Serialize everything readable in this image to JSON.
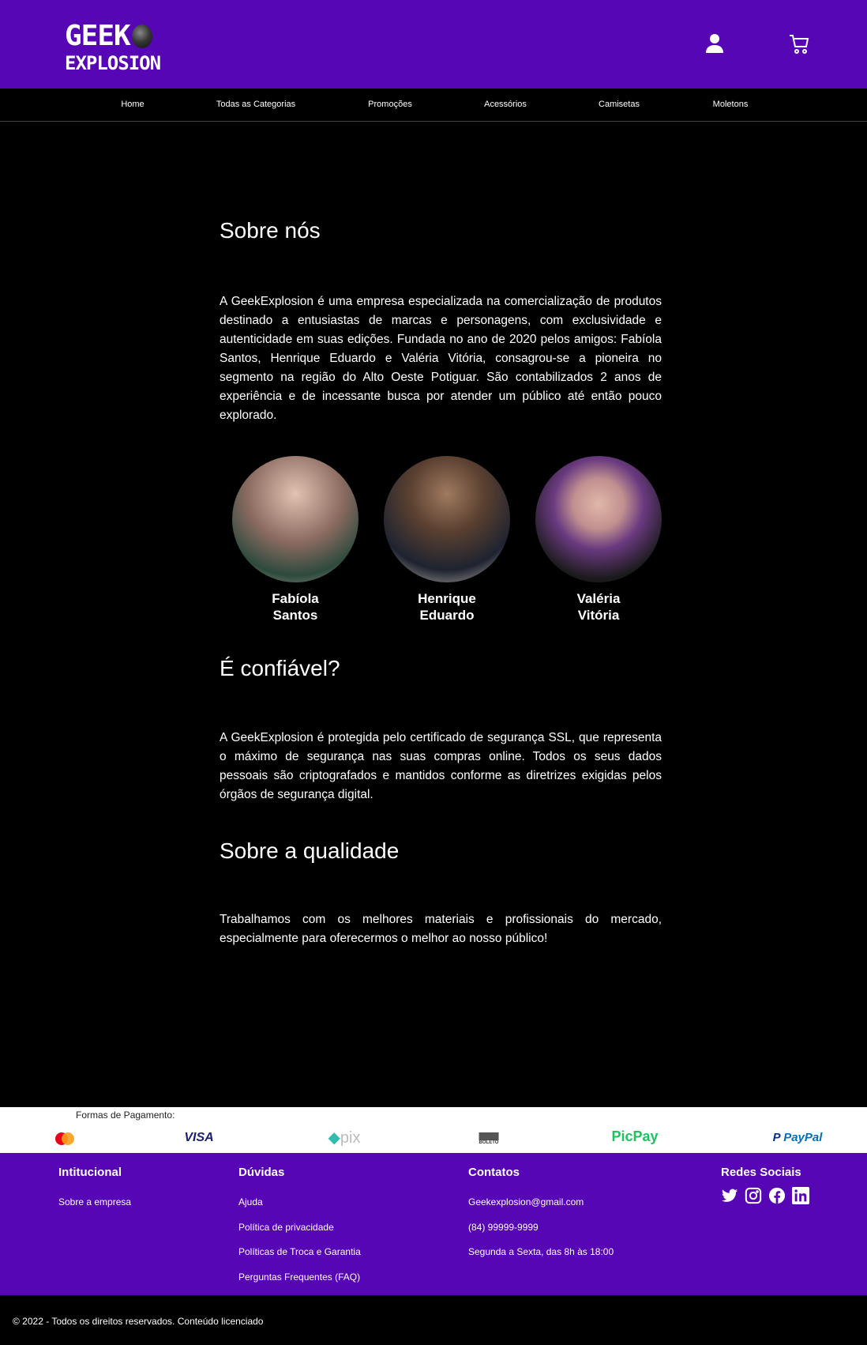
{
  "header": {
    "logo_line1": "GEEK",
    "logo_line2": "EXPLOSION",
    "icons": [
      "user-icon",
      "cart-icon"
    ]
  },
  "nav": [
    "Home",
    "Todas as Categorias",
    "Promoções",
    "Acessórios",
    "Camisetas",
    "Moletons"
  ],
  "about": {
    "title": "Sobre nós",
    "text": "A GeekExplosion é uma empresa especializada na comercialização de produtos destinado a entusiastas de marcas e personagens, com exclusividade e autenticidade em suas edições. Fundada no ano de 2020 pelos amigos: Fabíola Santos, Henrique Eduardo e Valéria Vitória, consagrou-se a pioneira no segmento na região do Alto Oeste Potiguar. São contabilizados 2 anos de experiência e de incessante busca por atender um público até então pouco explorado."
  },
  "team": [
    {
      "first": "Fabíola",
      "last": "Santos"
    },
    {
      "first": "Henrique",
      "last": "Eduardo"
    },
    {
      "first": "Valéria",
      "last": "Vitória"
    }
  ],
  "trust": {
    "title": "É confiável?",
    "text": "A GeekExplosion é protegida pelo certificado de segurança SSL, que representa o máximo de segurança nas suas compras online. Todos os seus dados pessoais são criptografados e mantidos conforme as diretrizes exigidas pelos órgãos de segurança digital."
  },
  "quality": {
    "title": "Sobre a qualidade",
    "text": "Trabalhamos com os melhores materiais e profissionais do mercado, especialmente para oferecermos o melhor ao nosso público!"
  },
  "payment": {
    "label": "Formas de Pagamento:",
    "methods": [
      "mastercard",
      "VISA",
      "pix",
      "BOLETO",
      "PicPay",
      "PayPal"
    ]
  },
  "footer": {
    "institutional": {
      "title": "Intitucional",
      "links": [
        "Sobre a empresa"
      ]
    },
    "questions": {
      "title": "Dúvidas",
      "links": [
        "Ajuda",
        "Política de privacidade",
        "Políticas de Troca e Garantia",
        "Perguntas Frequentes (FAQ)"
      ]
    },
    "contacts": {
      "title": "Contatos",
      "items": [
        "Geekexplosion@gmail.com",
        "(84) 99999-9999",
        "Segunda a Sexta, das 8h às 18:00"
      ]
    },
    "social": {
      "title": "Redes Sociais",
      "icons": [
        "twitter-icon",
        "instagram-icon",
        "facebook-icon",
        "linkedin-icon"
      ]
    },
    "copyright": "© 2022 - Todos os direitos reservados. Conteúdo licenciado"
  },
  "colors": {
    "brand": "#5606b4",
    "background": "#000000"
  }
}
